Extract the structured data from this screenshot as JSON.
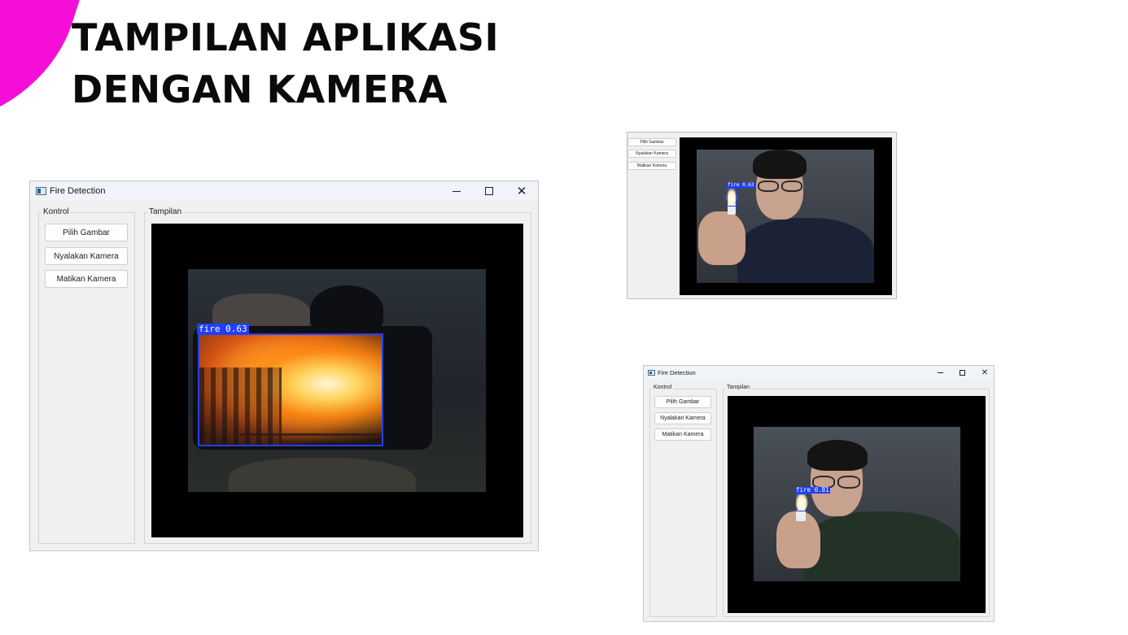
{
  "slide": {
    "title_line1": "TAMPILAN APLIKASI",
    "title_line2": "DENGAN KAMERA",
    "accent_color": "#f50fd6"
  },
  "windows": {
    "main": {
      "title": "Fire Detection",
      "controls_group": "Kontrol",
      "view_group": "Tampilan",
      "buttons": [
        "Pilih Gambar",
        "Nyalakan Kamera",
        "Matikan Kamera"
      ],
      "detection": {
        "label": "fire",
        "confidence": "0.63"
      }
    },
    "cropped": {
      "buttons": [
        "Pilih Gambar",
        "Nyalakan Kamera",
        "Matikan Kamera"
      ],
      "detection": {
        "label": "fire",
        "confidence": "0.63"
      }
    },
    "second": {
      "title": "Fire Detection",
      "controls_group": "Kontrol",
      "view_group": "Tampilan",
      "buttons": [
        "Pilih Gambar",
        "Nyalakan Kamera",
        "Matikan Kamera"
      ],
      "detection": {
        "label": "fire",
        "confidence": "0.81"
      }
    }
  },
  "icons": {
    "app": "window-app-icon",
    "minimize": "minimize-icon",
    "maximize": "maximize-icon",
    "close": "close-icon"
  },
  "colors": {
    "detection_box": "#2040ff",
    "viewport_bg": "#000000",
    "window_bg": "#f0f0f0"
  }
}
